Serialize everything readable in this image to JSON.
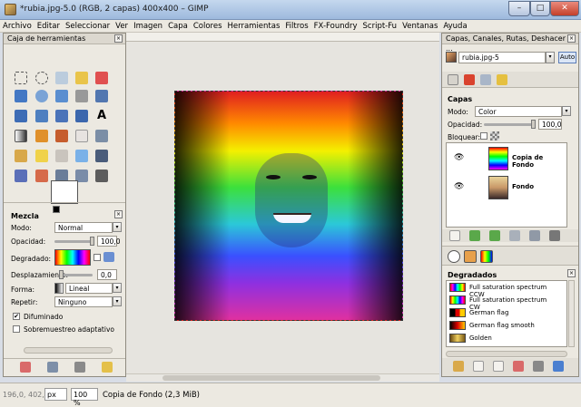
{
  "window": {
    "title": "*rubia.jpg-5.0 (RGB, 2 capas) 400x400 – GIMP",
    "minimize": "–",
    "maximize": "□",
    "close": "✕"
  },
  "menu": [
    "Archivo",
    "Editar",
    "Seleccionar",
    "Ver",
    "Imagen",
    "Capa",
    "Colores",
    "Herramientas",
    "Filtros",
    "FX-Foundry",
    "Script-Fu",
    "Ventanas",
    "Ayuda"
  ],
  "toolbox": {
    "title": "Caja de herramientas",
    "options_title": "Mezcla",
    "mode_label": "Modo:",
    "mode_value": "Normal",
    "opacity_label": "Opacidad:",
    "opacity_value": "100,0",
    "gradient_label": "Degradado:",
    "offset_label": "Desplazamiento:",
    "offset_value": "0,0",
    "shape_label": "Forma:",
    "shape_value": "Lineal",
    "repeat_label": "Repetir:",
    "repeat_value": "Ninguno",
    "dither_label": "Difuminado",
    "dither_checked": "✔",
    "adaptive_label": "Sobremuestreo adaptativo"
  },
  "dock": {
    "title": "Capas, Canales, Rutas, Deshacer - ...",
    "image_name": "rubia.jpg-5",
    "auto_label": "Auto",
    "layers_title": "Capas",
    "mode_label": "Modo:",
    "mode_value": "Color",
    "opacity_label": "Opacidad:",
    "opacity_value": "100,0",
    "lock_label": "Bloquear:",
    "layers": [
      {
        "name": "Copia de Fondo",
        "visible": "👁"
      },
      {
        "name": "Fondo",
        "visible": "👁"
      }
    ],
    "gradients_title": "Degradados",
    "gradients": [
      {
        "name": "Full saturation spectrum CCW"
      },
      {
        "name": "Full saturation spectrum CW"
      },
      {
        "name": "German flag"
      },
      {
        "name": "German flag smooth"
      },
      {
        "name": "Golden"
      }
    ]
  },
  "status": {
    "coords": "196,0, 402,0",
    "unit": "px",
    "zoom": "100 %",
    "info": "Copia de Fondo (2,3 MiB)"
  },
  "colors": {
    "accent": "#3a6ea5"
  }
}
